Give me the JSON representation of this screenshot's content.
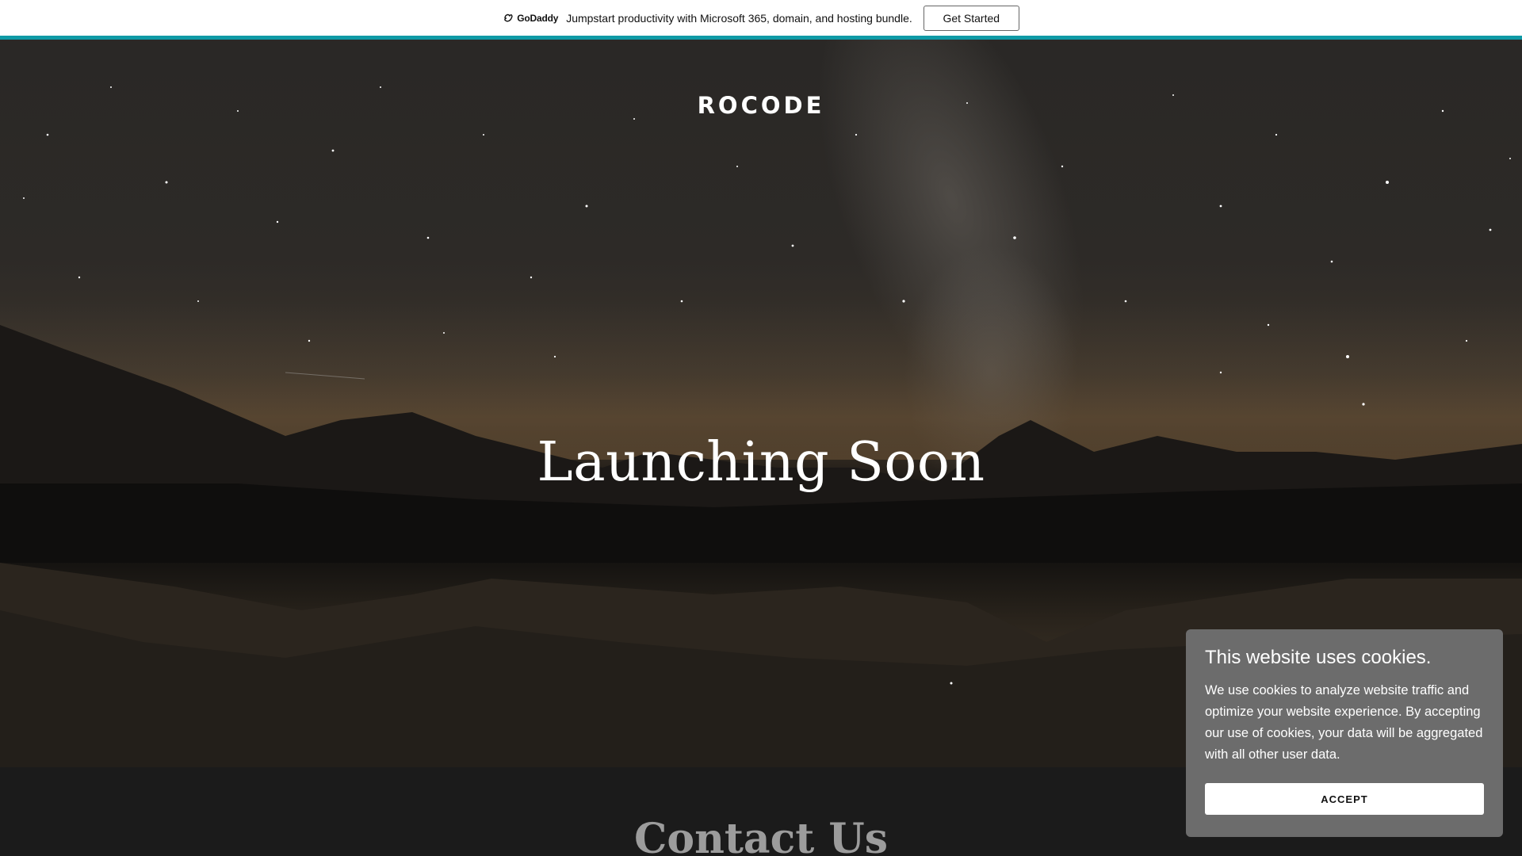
{
  "promo": {
    "logo_text": "GoDaddy",
    "message": "Jumpstart productivity with Microsoft 365, domain, and hosting bundle.",
    "button_label": "Get Started"
  },
  "header": {
    "site_title": "ROCODE"
  },
  "hero": {
    "heading": "Launching Soon"
  },
  "contact": {
    "heading": "Contact Us"
  },
  "cookie_banner": {
    "title": "This website uses cookies.",
    "body": "We use cookies to analyze website traffic and optimize your website experience. By accepting our use of cookies, your data will be aggregated with all other user data.",
    "accept_label": "ACCEPT"
  },
  "colors": {
    "accent_teal": "#0f9aa6",
    "cookie_panel": "#6c6c6c",
    "page_dark": "#1b1b1b"
  }
}
